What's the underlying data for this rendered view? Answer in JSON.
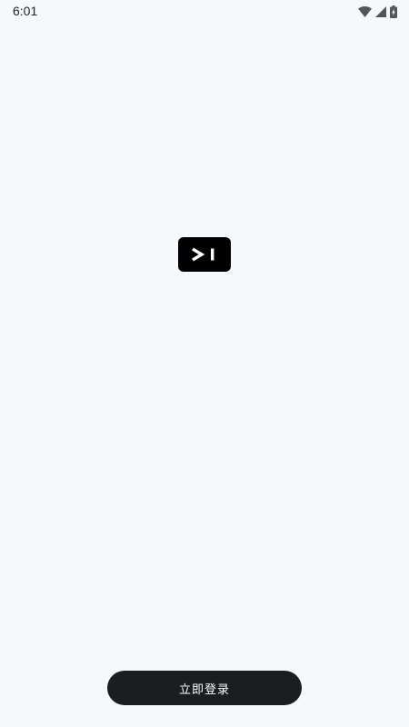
{
  "status_bar": {
    "time": "6:01",
    "icons": [
      "wifi-icon",
      "cellular-signal-icon",
      "battery-charging-icon"
    ]
  },
  "logo": {
    "icon": "terminal-prompt-icon",
    "background_color": "#000000",
    "foreground_color": "#ffffff"
  },
  "login_button": {
    "label": "立即登录",
    "background_color": "#1c1d21",
    "text_color": "#ffffff"
  },
  "page_background_color": "#f5f9fc"
}
